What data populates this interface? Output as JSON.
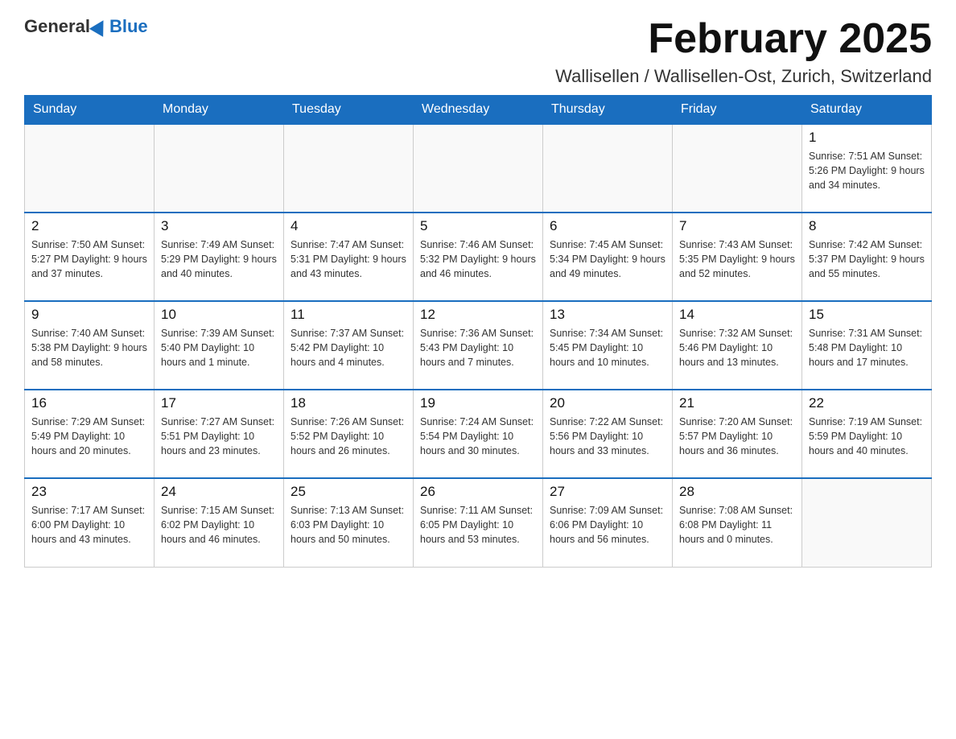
{
  "header": {
    "logo_general": "General",
    "logo_blue": "Blue",
    "month_title": "February 2025",
    "location": "Wallisellen / Wallisellen-Ost, Zurich, Switzerland"
  },
  "days_of_week": [
    "Sunday",
    "Monday",
    "Tuesday",
    "Wednesday",
    "Thursday",
    "Friday",
    "Saturday"
  ],
  "weeks": [
    {
      "days": [
        {
          "number": "",
          "info": ""
        },
        {
          "number": "",
          "info": ""
        },
        {
          "number": "",
          "info": ""
        },
        {
          "number": "",
          "info": ""
        },
        {
          "number": "",
          "info": ""
        },
        {
          "number": "",
          "info": ""
        },
        {
          "number": "1",
          "info": "Sunrise: 7:51 AM\nSunset: 5:26 PM\nDaylight: 9 hours\nand 34 minutes."
        }
      ]
    },
    {
      "days": [
        {
          "number": "2",
          "info": "Sunrise: 7:50 AM\nSunset: 5:27 PM\nDaylight: 9 hours\nand 37 minutes."
        },
        {
          "number": "3",
          "info": "Sunrise: 7:49 AM\nSunset: 5:29 PM\nDaylight: 9 hours\nand 40 minutes."
        },
        {
          "number": "4",
          "info": "Sunrise: 7:47 AM\nSunset: 5:31 PM\nDaylight: 9 hours\nand 43 minutes."
        },
        {
          "number": "5",
          "info": "Sunrise: 7:46 AM\nSunset: 5:32 PM\nDaylight: 9 hours\nand 46 minutes."
        },
        {
          "number": "6",
          "info": "Sunrise: 7:45 AM\nSunset: 5:34 PM\nDaylight: 9 hours\nand 49 minutes."
        },
        {
          "number": "7",
          "info": "Sunrise: 7:43 AM\nSunset: 5:35 PM\nDaylight: 9 hours\nand 52 minutes."
        },
        {
          "number": "8",
          "info": "Sunrise: 7:42 AM\nSunset: 5:37 PM\nDaylight: 9 hours\nand 55 minutes."
        }
      ]
    },
    {
      "days": [
        {
          "number": "9",
          "info": "Sunrise: 7:40 AM\nSunset: 5:38 PM\nDaylight: 9 hours\nand 58 minutes."
        },
        {
          "number": "10",
          "info": "Sunrise: 7:39 AM\nSunset: 5:40 PM\nDaylight: 10 hours\nand 1 minute."
        },
        {
          "number": "11",
          "info": "Sunrise: 7:37 AM\nSunset: 5:42 PM\nDaylight: 10 hours\nand 4 minutes."
        },
        {
          "number": "12",
          "info": "Sunrise: 7:36 AM\nSunset: 5:43 PM\nDaylight: 10 hours\nand 7 minutes."
        },
        {
          "number": "13",
          "info": "Sunrise: 7:34 AM\nSunset: 5:45 PM\nDaylight: 10 hours\nand 10 minutes."
        },
        {
          "number": "14",
          "info": "Sunrise: 7:32 AM\nSunset: 5:46 PM\nDaylight: 10 hours\nand 13 minutes."
        },
        {
          "number": "15",
          "info": "Sunrise: 7:31 AM\nSunset: 5:48 PM\nDaylight: 10 hours\nand 17 minutes."
        }
      ]
    },
    {
      "days": [
        {
          "number": "16",
          "info": "Sunrise: 7:29 AM\nSunset: 5:49 PM\nDaylight: 10 hours\nand 20 minutes."
        },
        {
          "number": "17",
          "info": "Sunrise: 7:27 AM\nSunset: 5:51 PM\nDaylight: 10 hours\nand 23 minutes."
        },
        {
          "number": "18",
          "info": "Sunrise: 7:26 AM\nSunset: 5:52 PM\nDaylight: 10 hours\nand 26 minutes."
        },
        {
          "number": "19",
          "info": "Sunrise: 7:24 AM\nSunset: 5:54 PM\nDaylight: 10 hours\nand 30 minutes."
        },
        {
          "number": "20",
          "info": "Sunrise: 7:22 AM\nSunset: 5:56 PM\nDaylight: 10 hours\nand 33 minutes."
        },
        {
          "number": "21",
          "info": "Sunrise: 7:20 AM\nSunset: 5:57 PM\nDaylight: 10 hours\nand 36 minutes."
        },
        {
          "number": "22",
          "info": "Sunrise: 7:19 AM\nSunset: 5:59 PM\nDaylight: 10 hours\nand 40 minutes."
        }
      ]
    },
    {
      "days": [
        {
          "number": "23",
          "info": "Sunrise: 7:17 AM\nSunset: 6:00 PM\nDaylight: 10 hours\nand 43 minutes."
        },
        {
          "number": "24",
          "info": "Sunrise: 7:15 AM\nSunset: 6:02 PM\nDaylight: 10 hours\nand 46 minutes."
        },
        {
          "number": "25",
          "info": "Sunrise: 7:13 AM\nSunset: 6:03 PM\nDaylight: 10 hours\nand 50 minutes."
        },
        {
          "number": "26",
          "info": "Sunrise: 7:11 AM\nSunset: 6:05 PM\nDaylight: 10 hours\nand 53 minutes."
        },
        {
          "number": "27",
          "info": "Sunrise: 7:09 AM\nSunset: 6:06 PM\nDaylight: 10 hours\nand 56 minutes."
        },
        {
          "number": "28",
          "info": "Sunrise: 7:08 AM\nSunset: 6:08 PM\nDaylight: 11 hours\nand 0 minutes."
        },
        {
          "number": "",
          "info": ""
        }
      ]
    }
  ]
}
